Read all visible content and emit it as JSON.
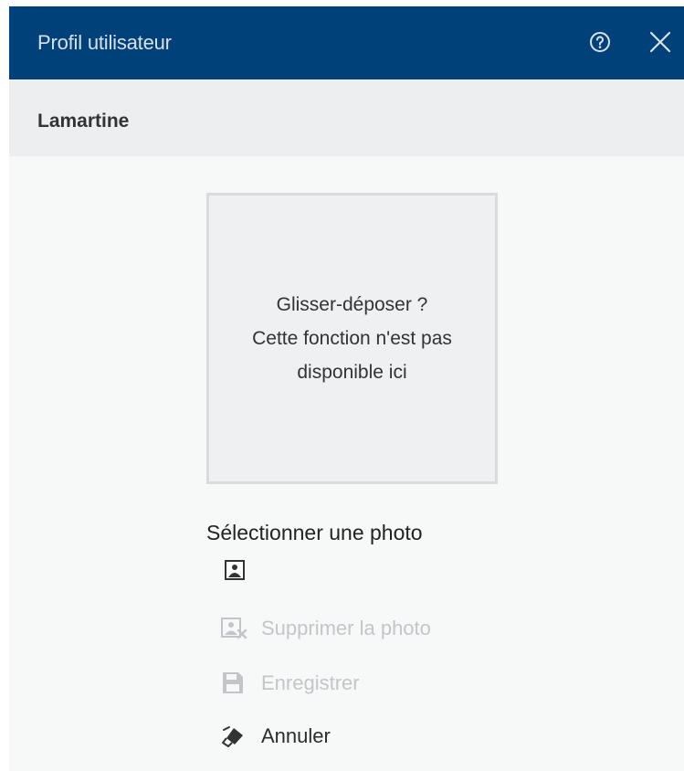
{
  "header": {
    "title": "Profil utilisateur",
    "help_icon": "help-circle-icon",
    "close_icon": "close-icon"
  },
  "subheader": {
    "name": "Lamartine"
  },
  "dropzone": {
    "line1": "Glisser-déposer ?",
    "line2": "Cette fonction n'est pas",
    "line3": "disponible ici"
  },
  "photo": {
    "select_label": "Sélectionner une photo",
    "select_icon": "image-icon"
  },
  "actions": {
    "delete_label": "Supprimer la photo",
    "delete_icon": "image-remove-icon",
    "save_label": "Enregistrer",
    "save_icon": "floppy-disk-icon",
    "cancel_label": "Annuler",
    "cancel_icon": "eraser-icon"
  },
  "colors": {
    "header_bg": "#00417a",
    "disabled_text": "#c3c6c9"
  }
}
